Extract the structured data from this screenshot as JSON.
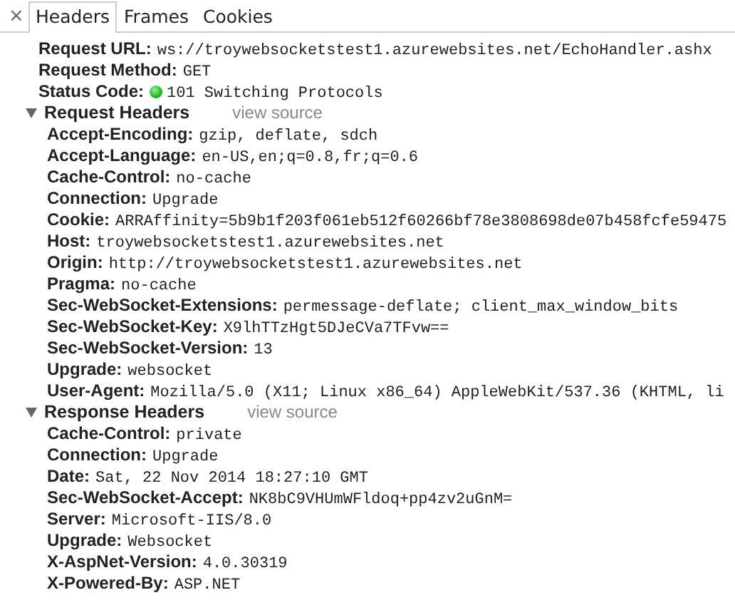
{
  "close_glyph": "×",
  "tabs": [
    {
      "label": "Headers",
      "selected": true
    },
    {
      "label": "Frames",
      "selected": false
    },
    {
      "label": "Cookies",
      "selected": false
    }
  ],
  "general": [
    {
      "name": "Request URL:",
      "value": "ws://troywebsocketstest1.azurewebsites.net/EchoHandler.ashx",
      "status": false
    },
    {
      "name": "Request Method:",
      "value": "GET",
      "status": false
    },
    {
      "name": "Status Code:",
      "value": "101 Switching Protocols",
      "status": true
    }
  ],
  "sections": [
    {
      "title": "Request Headers",
      "link": "view source",
      "expanded": true,
      "headers": [
        {
          "name": "Accept-Encoding:",
          "value": "gzip, deflate, sdch"
        },
        {
          "name": "Accept-Language:",
          "value": "en-US,en;q=0.8,fr;q=0.6"
        },
        {
          "name": "Cache-Control:",
          "value": "no-cache"
        },
        {
          "name": "Connection:",
          "value": "Upgrade"
        },
        {
          "name": "Cookie:",
          "value": "ARRAffinity=5b9b1f203f061eb512f60266bf78e3808698de07b458fcfe59475"
        },
        {
          "name": "Host:",
          "value": "troywebsocketstest1.azurewebsites.net"
        },
        {
          "name": "Origin:",
          "value": "http://troywebsocketstest1.azurewebsites.net"
        },
        {
          "name": "Pragma:",
          "value": "no-cache"
        },
        {
          "name": "Sec-WebSocket-Extensions:",
          "value": "permessage-deflate; client_max_window_bits"
        },
        {
          "name": "Sec-WebSocket-Key:",
          "value": "X9lhTTzHgt5DJeCVa7TFvw=="
        },
        {
          "name": "Sec-WebSocket-Version:",
          "value": "13"
        },
        {
          "name": "Upgrade:",
          "value": "websocket"
        },
        {
          "name": "User-Agent:",
          "value": "Mozilla/5.0 (X11; Linux x86_64) AppleWebKit/537.36 (KHTML, li"
        }
      ]
    },
    {
      "title": "Response Headers",
      "link": "view source",
      "expanded": true,
      "headers": [
        {
          "name": "Cache-Control:",
          "value": "private"
        },
        {
          "name": "Connection:",
          "value": "Upgrade"
        },
        {
          "name": "Date:",
          "value": "Sat, 22 Nov 2014 18:27:10 GMT"
        },
        {
          "name": "Sec-WebSocket-Accept:",
          "value": "NK8bC9VHUmWFldoq+pp4zv2uGnM="
        },
        {
          "name": "Server:",
          "value": "Microsoft-IIS/8.0"
        },
        {
          "name": "Upgrade:",
          "value": "Websocket"
        },
        {
          "name": "X-AspNet-Version:",
          "value": "4.0.30319"
        },
        {
          "name": "X-Powered-By:",
          "value": "ASP.NET"
        }
      ]
    }
  ]
}
